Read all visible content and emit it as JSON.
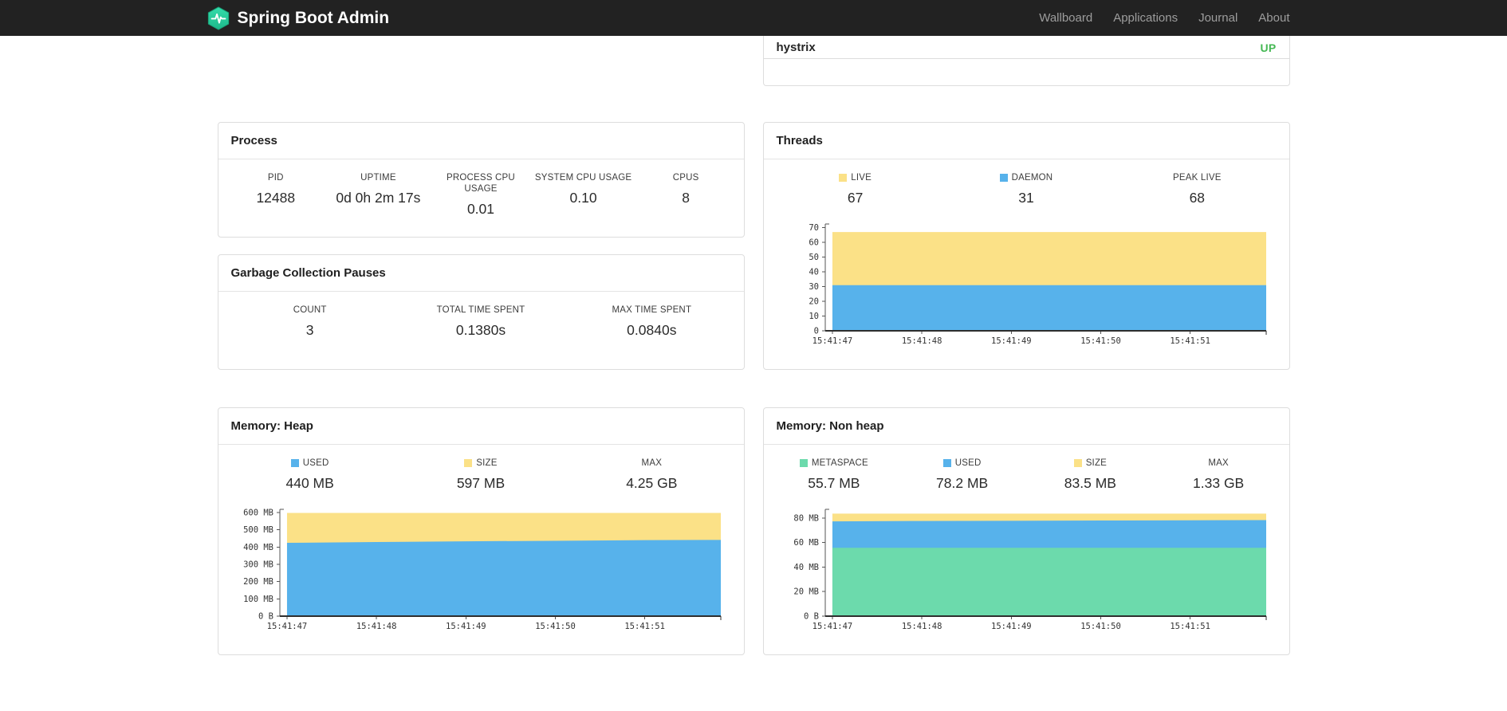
{
  "navbar": {
    "brand": "Spring Boot Admin",
    "links": [
      "Wallboard",
      "Applications",
      "Journal",
      "About"
    ]
  },
  "colors": {
    "navbar_bg": "#222222",
    "brand_teal": "#2bd3a4",
    "status_up": "#45b854",
    "series_yellow": "#fbe187",
    "series_blue": "#57b2eb",
    "series_green": "#6cdaac"
  },
  "health_panel": {
    "items": [
      {
        "name": "hystrix",
        "status": "UP",
        "status_color": "#45b854"
      }
    ]
  },
  "process": {
    "title": "Process",
    "stats": [
      {
        "label": "PID",
        "value": "12488"
      },
      {
        "label": "UPTIME",
        "value": "0d 0h 2m 17s"
      },
      {
        "label": "PROCESS CPU USAGE",
        "value": "0.01"
      },
      {
        "label": "SYSTEM CPU USAGE",
        "value": "0.10"
      },
      {
        "label": "CPUS",
        "value": "8"
      }
    ]
  },
  "gc": {
    "title": "Garbage Collection Pauses",
    "stats": [
      {
        "label": "COUNT",
        "value": "3"
      },
      {
        "label": "TOTAL TIME SPENT",
        "value": "0.1380s"
      },
      {
        "label": "MAX TIME SPENT",
        "value": "0.0840s"
      }
    ]
  },
  "threads": {
    "title": "Threads",
    "stats": [
      {
        "label": "LIVE",
        "value": "67",
        "swatch": "#fbe187"
      },
      {
        "label": "DAEMON",
        "value": "31",
        "swatch": "#57b2eb"
      },
      {
        "label": "PEAK LIVE",
        "value": "68"
      }
    ]
  },
  "heap": {
    "title": "Memory: Heap",
    "stats": [
      {
        "label": "USED",
        "value": "440 MB",
        "swatch": "#57b2eb"
      },
      {
        "label": "SIZE",
        "value": "597 MB",
        "swatch": "#fbe187"
      },
      {
        "label": "MAX",
        "value": "4.25 GB"
      }
    ]
  },
  "nonheap": {
    "title": "Memory: Non heap",
    "stats": [
      {
        "label": "METASPACE",
        "value": "55.7 MB",
        "swatch": "#6cdaac"
      },
      {
        "label": "USED",
        "value": "78.2 MB",
        "swatch": "#57b2eb"
      },
      {
        "label": "SIZE",
        "value": "83.5 MB",
        "swatch": "#fbe187"
      },
      {
        "label": "MAX",
        "value": "1.33 GB"
      }
    ]
  },
  "chart_data": [
    {
      "id": "threads",
      "type": "area",
      "title": "Threads",
      "x": [
        0,
        1,
        2,
        3,
        4,
        4.85
      ],
      "xlim": [
        -0.08,
        4.85
      ],
      "x_ticks": [
        0,
        1,
        2,
        3,
        4
      ],
      "x_tick_labels": [
        "15:41:47",
        "15:41:48",
        "15:41:49",
        "15:41:50",
        "15:41:51"
      ],
      "ylim": [
        0,
        72.5
      ],
      "y_ticks": [
        0,
        10,
        20,
        30,
        40,
        50,
        60,
        70
      ],
      "y_tick_labels": [
        "0",
        "10",
        "20",
        "30",
        "40",
        "50",
        "60",
        "70"
      ],
      "grid": false,
      "series": [
        {
          "name": "LIVE",
          "color": "#fbe187",
          "values": [
            67,
            67,
            67,
            67,
            67,
            67
          ]
        },
        {
          "name": "DAEMON",
          "color": "#57b2eb",
          "values": [
            31,
            31,
            31,
            31,
            31,
            31
          ]
        }
      ]
    },
    {
      "id": "memory-heap",
      "type": "area",
      "title": "Memory: Heap",
      "x": [
        0,
        1,
        2,
        3,
        4,
        4.85
      ],
      "xlim": [
        -0.08,
        4.85
      ],
      "x_ticks": [
        0,
        1,
        2,
        3,
        4
      ],
      "x_tick_labels": [
        "15:41:47",
        "15:41:48",
        "15:41:49",
        "15:41:50",
        "15:41:51"
      ],
      "ylim": [
        0,
        618
      ],
      "y_ticks": [
        0,
        100,
        200,
        300,
        400,
        500,
        600
      ],
      "y_tick_labels": [
        "0 B",
        "100 MB",
        "200 MB",
        "300 MB",
        "400 MB",
        "500 MB",
        "600 MB"
      ],
      "grid": false,
      "series": [
        {
          "name": "SIZE",
          "color": "#fbe187",
          "values": [
            597,
            597,
            597,
            597,
            597,
            597
          ]
        },
        {
          "name": "USED",
          "color": "#57b2eb",
          "values": [
            424,
            429,
            433,
            436,
            440,
            441
          ]
        }
      ]
    },
    {
      "id": "memory-nonheap",
      "type": "area",
      "title": "Memory: Non heap",
      "x": [
        0,
        1,
        2,
        3,
        4,
        4.85
      ],
      "xlim": [
        -0.08,
        4.85
      ],
      "x_ticks": [
        0,
        1,
        2,
        3,
        4
      ],
      "x_tick_labels": [
        "15:41:47",
        "15:41:48",
        "15:41:49",
        "15:41:50",
        "15:41:51"
      ],
      "ylim": [
        0,
        87
      ],
      "y_ticks": [
        0,
        20,
        40,
        60,
        80
      ],
      "y_tick_labels": [
        "0 B",
        "20 MB",
        "40 MB",
        "60 MB",
        "80 MB"
      ],
      "grid": false,
      "series": [
        {
          "name": "SIZE",
          "color": "#fbe187",
          "values": [
            83.5,
            83.5,
            83.5,
            83.5,
            83.5,
            83.5
          ]
        },
        {
          "name": "USED",
          "color": "#57b2eb",
          "values": [
            77.2,
            77.5,
            77.7,
            77.9,
            78.1,
            78.2
          ]
        },
        {
          "name": "METASPACE",
          "color": "#6cdaac",
          "values": [
            55.7,
            55.7,
            55.7,
            55.7,
            55.7,
            55.7
          ]
        }
      ]
    }
  ]
}
